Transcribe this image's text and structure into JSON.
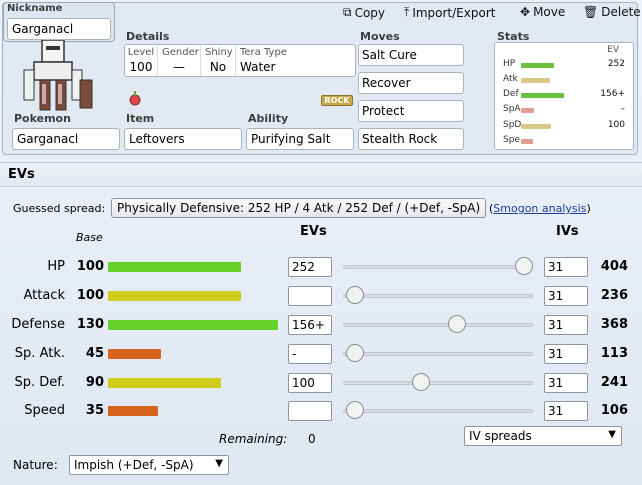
{
  "nickname": {
    "label": "Nickname",
    "value": "Garganacl"
  },
  "toolbar": {
    "copy": "Copy",
    "import_export": "Import/Export",
    "move": "Move",
    "delete": "Delete"
  },
  "details": {
    "label": "Details",
    "level_h": "Level",
    "level": "100",
    "gender_h": "Gender",
    "gender": "—",
    "shiny_h": "Shiny",
    "shiny": "No",
    "tera_h": "Tera Type",
    "tera": "Water"
  },
  "type_badge": "ROCK",
  "pokemon": {
    "label": "Pokemon",
    "value": "Garganacl"
  },
  "item": {
    "label": "Item",
    "value": "Leftovers"
  },
  "ability": {
    "label": "Ability",
    "value": "Purifying Salt"
  },
  "moves": {
    "label": "Moves",
    "list": [
      "Salt Cure",
      "Recover",
      "Protect",
      "Stealth Rock"
    ]
  },
  "stats_summary": {
    "label": "Stats",
    "ev_header": "EV",
    "rows": [
      {
        "name": "HP",
        "ev": "252",
        "fill": 0.55,
        "color": "#6bbf3a"
      },
      {
        "name": "Atk",
        "ev": "",
        "fill": 0.48,
        "color": "#d8c98a"
      },
      {
        "name": "Def",
        "ev": "156+",
        "fill": 0.72,
        "color": "#6bbf3a"
      },
      {
        "name": "SpA",
        "ev": "–",
        "fill": 0.22,
        "color": "#e0a090"
      },
      {
        "name": "SpD",
        "ev": "100",
        "fill": 0.5,
        "color": "#d8c98a"
      },
      {
        "name": "Spe",
        "ev": "",
        "fill": 0.2,
        "color": "#e0a090"
      }
    ]
  },
  "evs_section": {
    "title": "EVs",
    "guessed_label": "Guessed spread:",
    "guessed_button": "Physically Defensive: 252 HP / 4 Atk / 252 Def / (+Def, -SpA)",
    "smogon_prefix": "(",
    "smogon_link": "Smogon analysis",
    "smogon_suffix": ")",
    "col_base": "Base",
    "col_evs": "EVs",
    "col_ivs": "IVs",
    "rows": [
      {
        "name": "HP",
        "base": "100",
        "bar": 0.53,
        "color": "#63d12a",
        "ev": "252",
        "slider": 1.0,
        "iv": "31",
        "total": "404"
      },
      {
        "name": "Attack",
        "base": "100",
        "bar": 0.53,
        "color": "#cfcd1c",
        "ev": "",
        "slider": 0.02,
        "iv": "31",
        "total": "236"
      },
      {
        "name": "Defense",
        "base": "130",
        "bar": 0.68,
        "color": "#63d12a",
        "ev": "156+",
        "slider": 0.61,
        "iv": "31",
        "total": "368"
      },
      {
        "name": "Sp. Atk.",
        "base": "45",
        "bar": 0.21,
        "color": "#d8631a",
        "ev": "-",
        "slider": 0.02,
        "iv": "31",
        "total": "113"
      },
      {
        "name": "Sp. Def.",
        "base": "90",
        "bar": 0.45,
        "color": "#cfcd1c",
        "ev": "100",
        "slider": 0.4,
        "iv": "31",
        "total": "241"
      },
      {
        "name": "Speed",
        "base": "35",
        "bar": 0.2,
        "color": "#d8631a",
        "ev": "",
        "slider": 0.02,
        "iv": "31",
        "total": "106"
      }
    ],
    "remaining_label": "Remaining:",
    "remaining": "0",
    "iv_spreads": "IV spreads",
    "nature_label": "Nature:",
    "nature": "Impish (+Def, -SpA)"
  }
}
